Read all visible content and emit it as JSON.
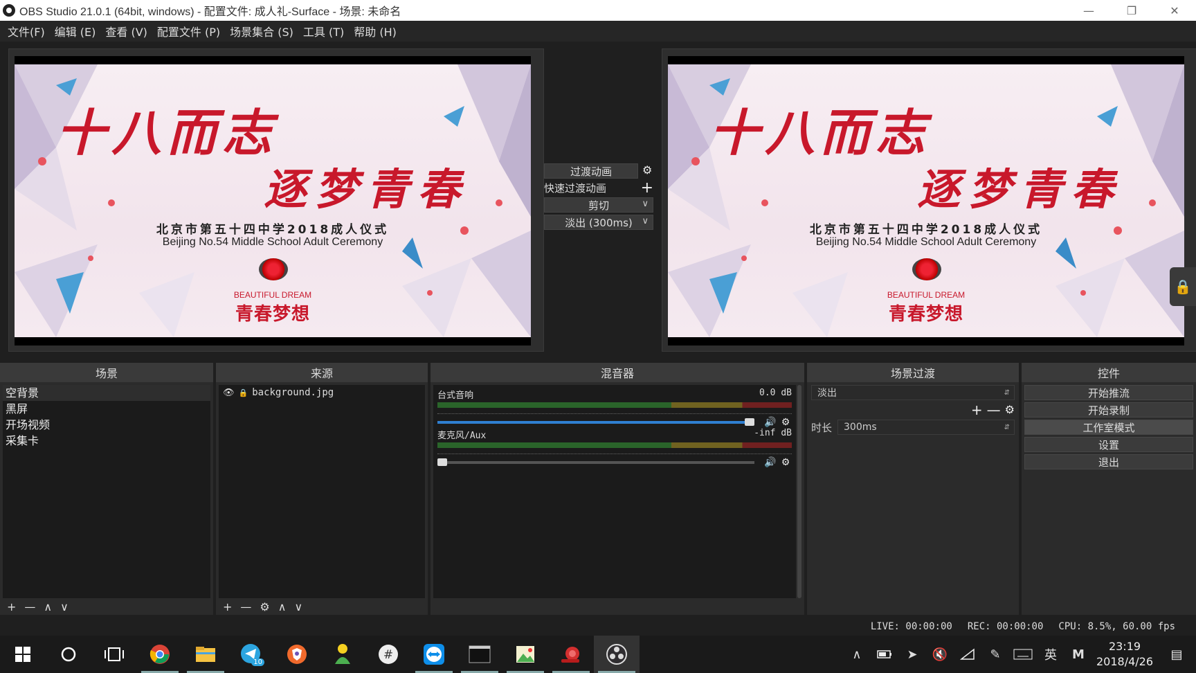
{
  "window": {
    "title": "OBS Studio 21.0.1 (64bit, windows) - 配置文件: 成人礼-Surface - 场景: 未命名"
  },
  "menu": [
    "文件(F)",
    "编辑 (E)",
    "查看 (V)",
    "配置文件 (P)",
    "场景集合 (S)",
    "工具 (T)",
    "帮助 (H)"
  ],
  "preview": {
    "title1": "十八而志",
    "title2": "逐梦青春",
    "cn_subtitle": "北京市第五十四中学2018成人仪式",
    "en_subtitle": "Beijing No.54 Middle School Adult Ceremony",
    "bd_en": "BEAUTIFUL DREAM",
    "bd_cn": "青春梦想"
  },
  "transition": {
    "transition_btn": "过渡动画",
    "quick_label": "快速过渡动画",
    "cut": "剪切",
    "fade": "淡出 (300ms)"
  },
  "docks": {
    "scenes_title": "场景",
    "sources_title": "来源",
    "mixer_title": "混音器",
    "transitions_title": "场景过渡",
    "controls_title": "控件"
  },
  "scenes": [
    "空背景",
    "黑屏",
    "开场视频",
    "采集卡"
  ],
  "sources": [
    "background.jpg"
  ],
  "mixer": [
    {
      "name": "台式音响",
      "level": "0.0 dB",
      "volume": 1.0
    },
    {
      "name": "麦克风/Aux",
      "level": "-inf dB",
      "volume": 0.0
    }
  ],
  "scene_transition": {
    "selected": "淡出",
    "duration_label": "时长",
    "duration_value": "300ms"
  },
  "controls": [
    "开始推流",
    "开始录制",
    "工作室模式",
    "设置",
    "退出"
  ],
  "status": {
    "live": "LIVE: 00:00:00",
    "rec": "REC: 00:00:00",
    "cpu": "CPU: 8.5%, 60.00 fps"
  },
  "taskbar": {
    "time": "23:19",
    "date": "2018/4/26",
    "ime": "英",
    "badge": "10"
  },
  "colors": {
    "accent_red": "#c8182b",
    "fader_blue": "#2f7fd1"
  }
}
